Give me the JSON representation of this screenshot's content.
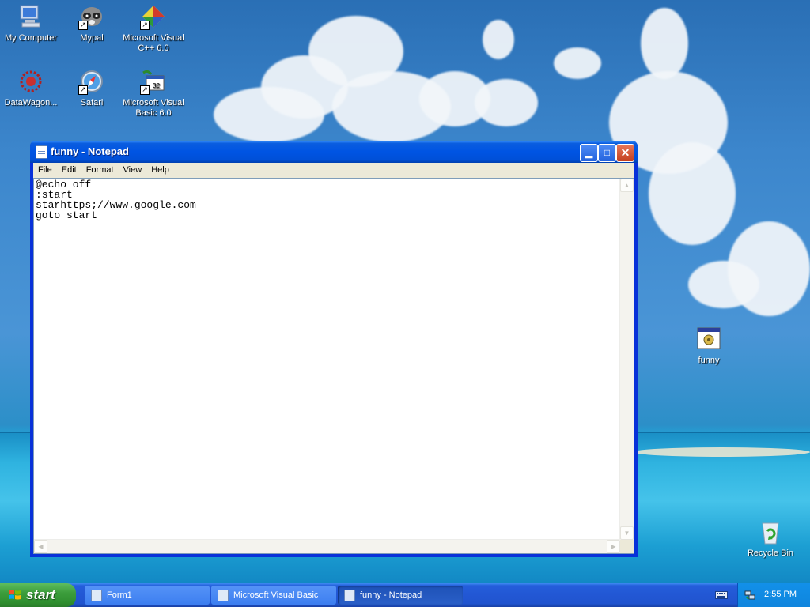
{
  "desktop": {
    "icons": [
      {
        "label": "My Computer"
      },
      {
        "label": "Mypal"
      },
      {
        "label": "Microsoft Visual C++ 6.0"
      },
      {
        "label": "DataWagon..."
      },
      {
        "label": "Safari"
      },
      {
        "label": "Microsoft Visual Basic 6.0"
      },
      {
        "label": "funny"
      },
      {
        "label": "Recycle Bin"
      }
    ]
  },
  "window": {
    "title": "funny - Notepad",
    "menu": [
      "File",
      "Edit",
      "Format",
      "View",
      "Help"
    ],
    "content": "@echo off\n:start\nstarhttps;//www.google.com\ngoto start"
  },
  "taskbar": {
    "start_label": "start",
    "items": [
      {
        "label": "Form1",
        "active": false
      },
      {
        "label": "Microsoft Visual Basic",
        "active": false
      },
      {
        "label": "funny - Notepad",
        "active": true
      }
    ],
    "clock": "2:55 PM"
  }
}
